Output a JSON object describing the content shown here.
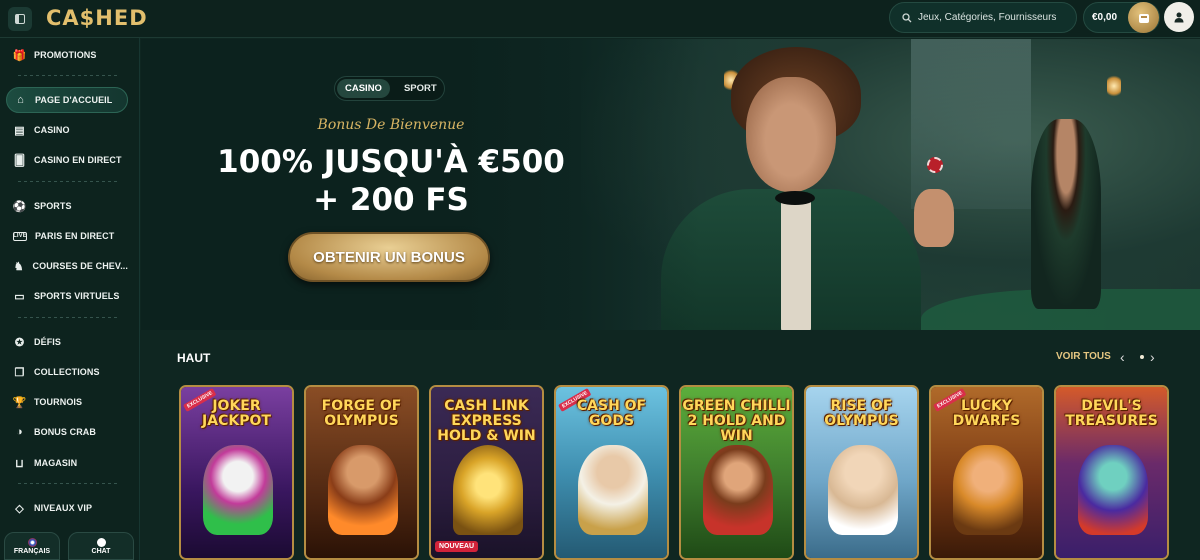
{
  "header": {
    "logo": "CA$HED",
    "search_placeholder": "Jeux, Catégories, Fournisseurs",
    "balance": "€0,00"
  },
  "sidebar": {
    "items": [
      {
        "label": "PROMOTIONS",
        "icon": "gift-icon"
      },
      {
        "label": "PAGE D'ACCUEIL",
        "icon": "home-icon",
        "active": true
      },
      {
        "label": "CASINO",
        "icon": "slot-icon"
      },
      {
        "label": "CASINO EN DIRECT",
        "icon": "live-cards-icon"
      },
      {
        "label": "SPORTS",
        "icon": "ball-icon"
      },
      {
        "label": "PARIS EN DIRECT",
        "icon": "live-icon"
      },
      {
        "label": "COURSES DE CHEV...",
        "icon": "horse-icon"
      },
      {
        "label": "SPORTS VIRTUELS",
        "icon": "monitor-icon"
      },
      {
        "label": "DÉFIS",
        "icon": "medal-icon"
      },
      {
        "label": "COLLECTIONS",
        "icon": "cards-icon"
      },
      {
        "label": "TOURNOIS",
        "icon": "trophy-icon"
      },
      {
        "label": "BONUS CRAB",
        "icon": "crab-icon"
      },
      {
        "label": "MAGASIN",
        "icon": "basket-icon"
      },
      {
        "label": "NIVEAUX VIP",
        "icon": "diamond-icon"
      }
    ],
    "language": "FRANÇAIS",
    "chat": "CHAT"
  },
  "hero": {
    "switch_casino": "CASINO",
    "switch_sport": "SPORT",
    "bonus_title": "Bonus De Bienvenue",
    "headline_line1": "100% JUSQU'À €500",
    "headline_line2": "+ 200 FS",
    "cta": "OBTENIR UN BONUS"
  },
  "top_section": {
    "title": "HAUT",
    "see_all": "VOIR TOUS",
    "games": [
      {
        "name": "JOKER JACKPOT",
        "badge": "EXCLUSIVE",
        "bg": "#5b2a7a",
        "accent": "#2fbf4a"
      },
      {
        "name": "FORGE OF OLYMPUS",
        "badge": "",
        "bg": "#6b3a1c",
        "accent": "#c46a2a"
      },
      {
        "name": "CASH LINK EXPRESS HOLD & WIN",
        "badge": "",
        "bg": "#2b1d3f",
        "accent": "#d9a428",
        "tag": "NOUVEAU"
      },
      {
        "name": "CASH OF GODS",
        "badge": "EXCLUSIVE",
        "bg": "#3f8fb0",
        "accent": "#e8e0c8"
      },
      {
        "name": "GREEN CHILLI 2 HOLD AND WIN",
        "badge": "",
        "bg": "#3d7a2c",
        "accent": "#c7332a"
      },
      {
        "name": "RISE OF OLYMPUS",
        "badge": "",
        "bg": "#6fa6c8",
        "accent": "#e9d7b8"
      },
      {
        "name": "LUCKY DWARFS",
        "badge": "EXCLUSIVE",
        "bg": "#7a3a14",
        "accent": "#d98a2a"
      },
      {
        "name": "DEVIL'S TREASURES",
        "badge": "",
        "bg": "#3a1f6a",
        "accent": "#d43a2a"
      }
    ]
  }
}
